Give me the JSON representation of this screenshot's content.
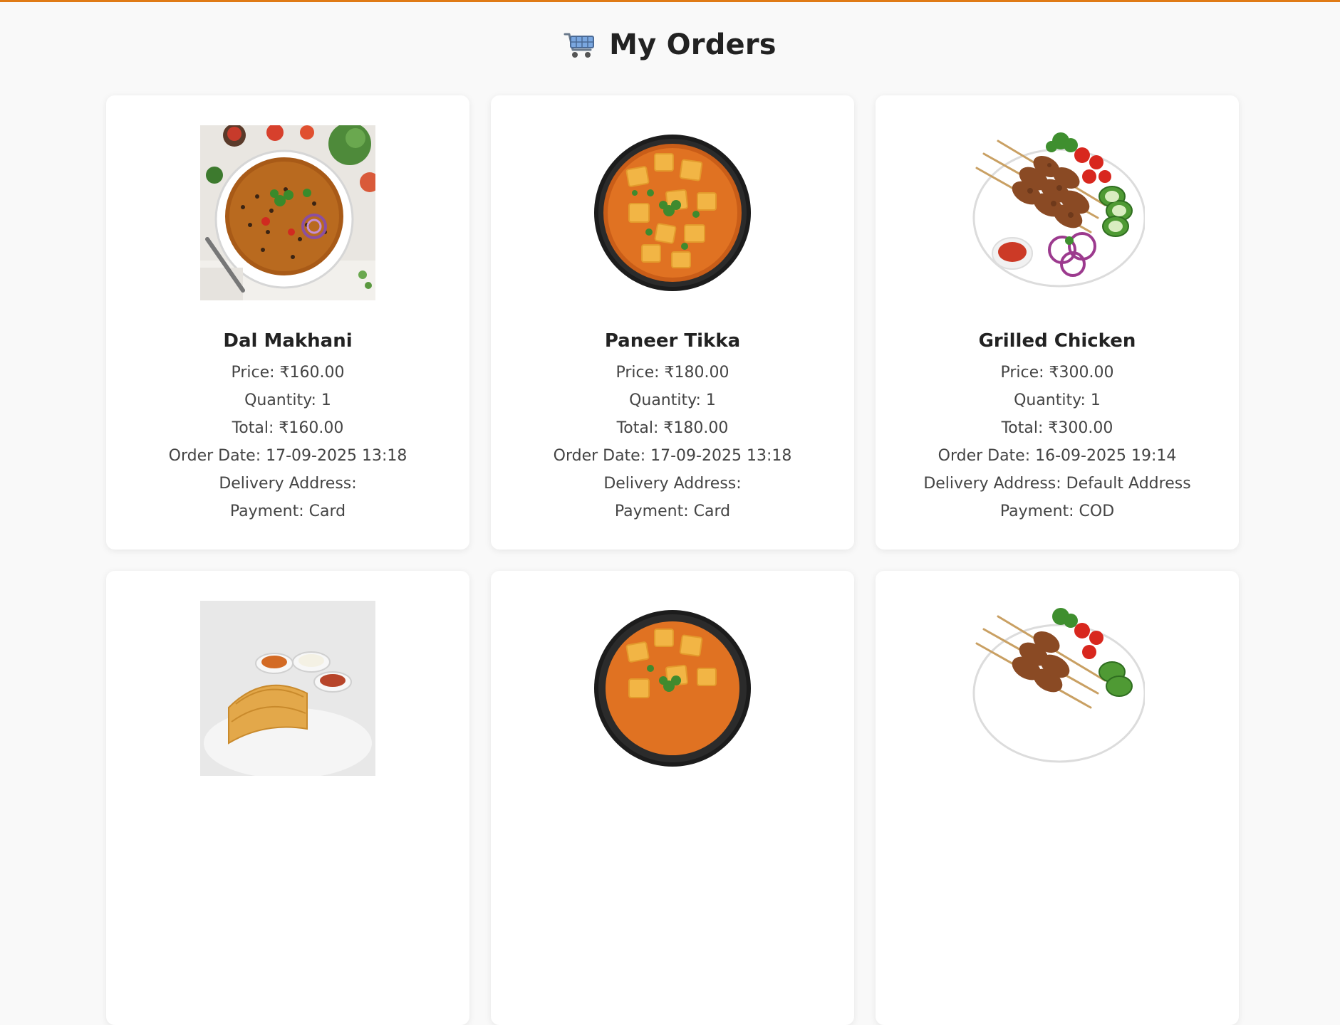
{
  "page": {
    "title": "My Orders",
    "icon": "shopping-cart-icon",
    "accent_color": "#e07b16",
    "background_color": "#f9f9f9"
  },
  "labels": {
    "price": "Price:",
    "quantity": "Quantity:",
    "total": "Total:",
    "order_date": "Order Date:",
    "delivery_address": "Delivery Address:",
    "payment": "Payment:"
  },
  "orders": [
    {
      "name": "Dal Makhani",
      "image": "dal-makhani-bowl-image",
      "price": "Price: ₹160.00",
      "quantity": "Quantity: 1",
      "total": "Total: ₹160.00",
      "order_date": "Order Date: 17-09-2025 13:18",
      "delivery_address": "Delivery Address:",
      "payment": "Payment: Card"
    },
    {
      "name": "Paneer Tikka",
      "image": "paneer-tikka-bowl-image",
      "price": "Price: ₹180.00",
      "quantity": "Quantity: 1",
      "total": "Total: ₹180.00",
      "order_date": "Order Date: 17-09-2025 13:18",
      "delivery_address": "Delivery Address:",
      "payment": "Payment: Card"
    },
    {
      "name": "Grilled Chicken",
      "image": "grilled-chicken-plate-image",
      "price": "Price: ₹300.00",
      "quantity": "Quantity: 1",
      "total": "Total: ₹300.00",
      "order_date": "Order Date: 16-09-2025 19:14",
      "delivery_address": "Delivery Address: Default Address",
      "payment": "Payment: COD"
    },
    {
      "image": "dosa-platter-image"
    },
    {
      "image": "paneer-tikka-bowl-image"
    },
    {
      "image": "grilled-chicken-plate-image"
    }
  ]
}
